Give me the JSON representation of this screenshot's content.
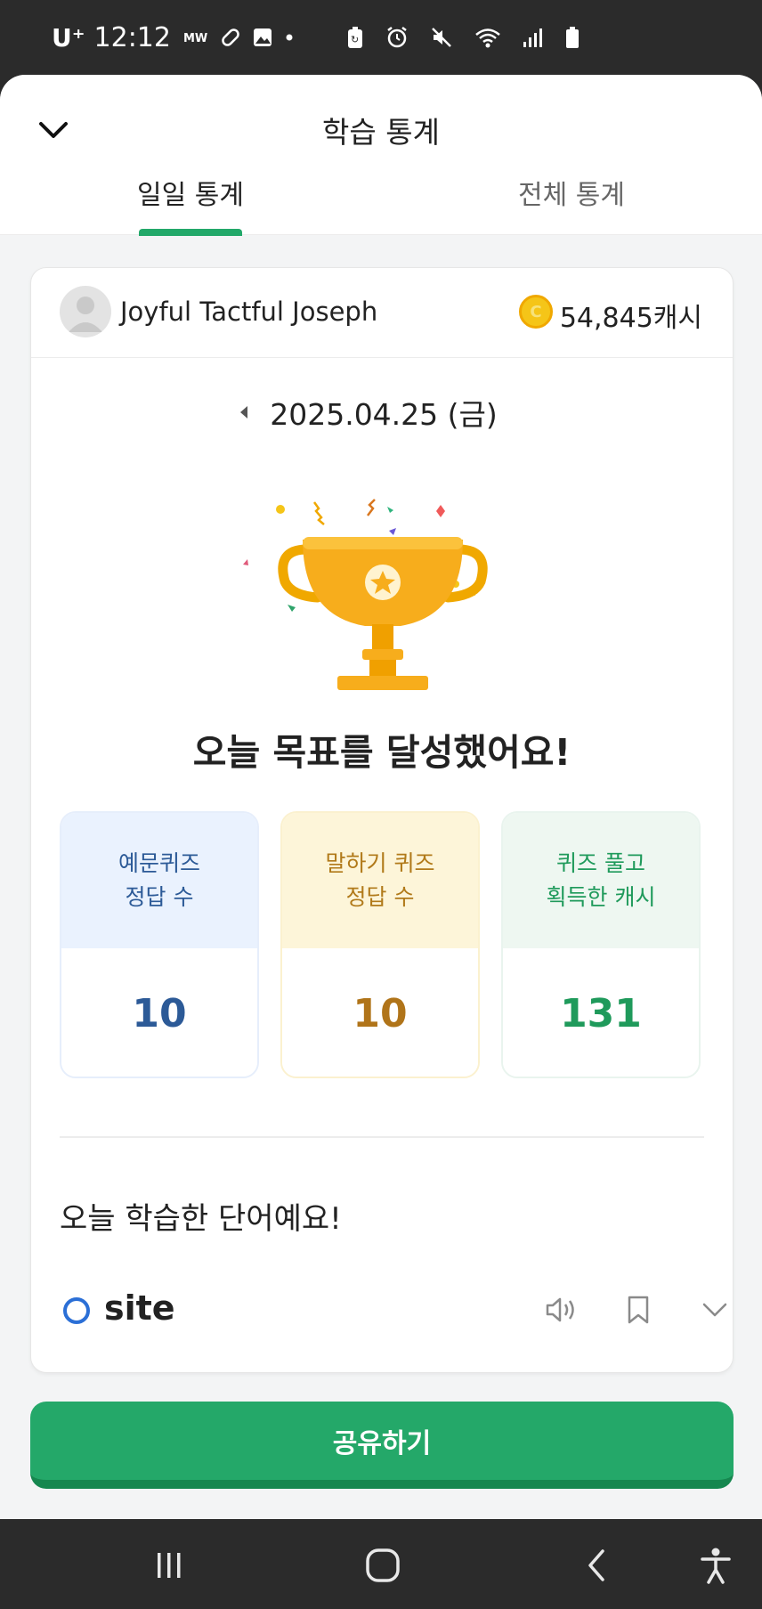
{
  "status_bar": {
    "carrier": "U⁺",
    "time": "12:12"
  },
  "header": {
    "title": "학습 통계",
    "tabs": [
      {
        "label": "일일 통계"
      },
      {
        "label": "전체 통계"
      }
    ]
  },
  "profile": {
    "name": "Joyful Tactful Joseph",
    "coin_symbol": "C",
    "cash": "54,845캐시"
  },
  "date": "2025.04.25 (금)",
  "goal_message": "오늘 목표를 달성했어요!",
  "stats": [
    {
      "label": "예문퀴즈\n정답 수",
      "value": "10"
    },
    {
      "label": "말하기 퀴즈\n정답 수",
      "value": "10"
    },
    {
      "label": "퀴즈 풀고\n획득한 캐시",
      "value": "131"
    }
  ],
  "learned_title": "오늘 학습한 단어예요!",
  "words": [
    {
      "word": "site"
    }
  ],
  "share_button": "공유하기",
  "colors": {
    "accent_green": "#24a869",
    "blue_stat": "#2c5a97",
    "yellow_stat": "#b07419",
    "green_stat": "#1f9a5b"
  }
}
